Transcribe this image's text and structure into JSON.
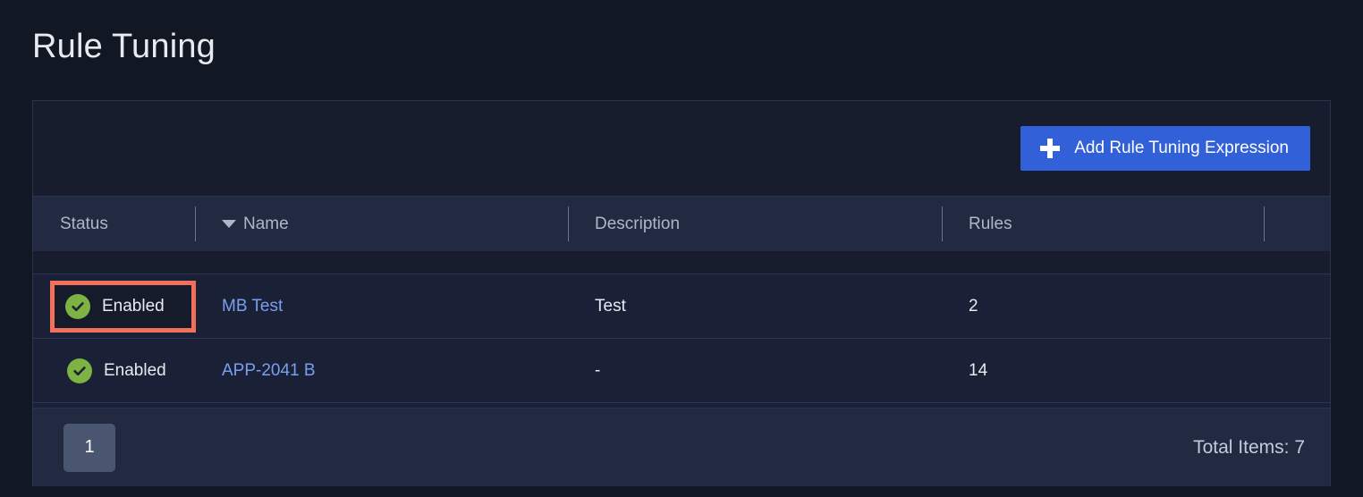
{
  "page": {
    "title": "Rule Tuning"
  },
  "toolbar": {
    "add_button_label": "Add Rule Tuning Expression",
    "add_button_icon": "plus-icon",
    "accent_color": "#3160d8"
  },
  "table": {
    "columns": [
      {
        "key": "status",
        "label": "Status",
        "sorted": false
      },
      {
        "key": "name",
        "label": "Name",
        "sorted": true,
        "sort_direction": "desc",
        "sort_icon": "caret-down-icon"
      },
      {
        "key": "description",
        "label": "Description",
        "sorted": false
      },
      {
        "key": "rules",
        "label": "Rules",
        "sorted": false
      },
      {
        "key": "actions",
        "label": "",
        "sorted": false
      }
    ],
    "rows": [
      {
        "status": "Enabled",
        "status_icon": "check-circle-icon",
        "status_color": "#7cb342",
        "highlighted": true,
        "highlight_color": "#f0705c",
        "name": "MB Test",
        "description": "Test",
        "rules": "2"
      },
      {
        "status": "Enabled",
        "status_icon": "check-circle-icon",
        "status_color": "#7cb342",
        "highlighted": false,
        "name": "APP-2041 B",
        "description": "-",
        "rules": "14"
      }
    ]
  },
  "footer": {
    "pages": [
      "1"
    ],
    "current_page": "1",
    "total_items_label": "Total Items: 7"
  }
}
